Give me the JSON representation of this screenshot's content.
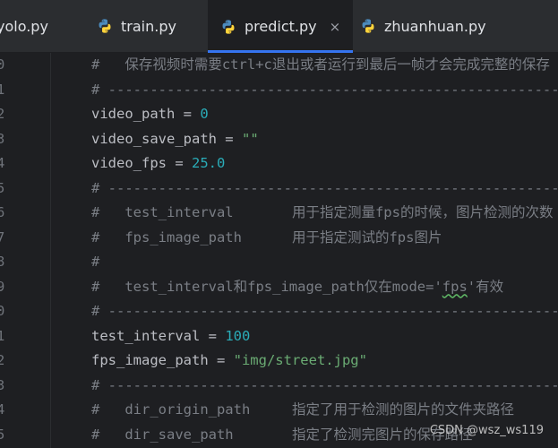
{
  "tabs": [
    {
      "label": "yolo.py",
      "active": false
    },
    {
      "label": "train.py",
      "active": false
    },
    {
      "label": "predict.py",
      "active": true,
      "close": "×"
    },
    {
      "label": "zhuanhuan.py",
      "active": false
    }
  ],
  "lines": [
    {
      "n": "0",
      "parts": [
        {
          "t": "#   保存视频时需要ctrl+c退出或者运行到最后一帧才会完成完整的保存",
          "c": "cmt"
        }
      ]
    },
    {
      "n": "1",
      "parts": [
        {
          "t": "# ------------------------------------------------------------------",
          "c": "cmt"
        }
      ]
    },
    {
      "n": "2",
      "parts": [
        {
          "t": "video_path = ",
          "c": ""
        },
        {
          "t": "0",
          "c": "num"
        }
      ]
    },
    {
      "n": "3",
      "parts": [
        {
          "t": "video_save_path = ",
          "c": ""
        },
        {
          "t": "\"\"",
          "c": "str"
        }
      ]
    },
    {
      "n": "4",
      "parts": [
        {
          "t": "video_fps = ",
          "c": ""
        },
        {
          "t": "25.0",
          "c": "num"
        }
      ]
    },
    {
      "n": "5",
      "parts": [
        {
          "t": "# ------------------------------------------------------------------",
          "c": "cmt"
        }
      ]
    },
    {
      "n": "6",
      "parts": [
        {
          "t": "#   test_interval       用于指定测量fps的时候，图片检测的次数",
          "c": "cmt"
        }
      ]
    },
    {
      "n": "7",
      "parts": [
        {
          "t": "#   fps_image_path      用于指定测试的fps图片",
          "c": "cmt"
        }
      ]
    },
    {
      "n": "8",
      "parts": [
        {
          "t": "#",
          "c": "cmt"
        }
      ]
    },
    {
      "n": "9",
      "parts": [
        {
          "t": "#   test_interval和fps_image_path仅在mode='",
          "c": "cmt"
        },
        {
          "t": "fps",
          "c": "cmt squiggle"
        },
        {
          "t": "'有效",
          "c": "cmt"
        }
      ]
    },
    {
      "n": "0",
      "parts": [
        {
          "t": "# ------------------------------------------------------------------",
          "c": "cmt"
        }
      ]
    },
    {
      "n": "1",
      "parts": [
        {
          "t": "test_interval = ",
          "c": ""
        },
        {
          "t": "100",
          "c": "num"
        }
      ]
    },
    {
      "n": "2",
      "parts": [
        {
          "t": "fps_image_path = ",
          "c": ""
        },
        {
          "t": "\"img/street.jpg\"",
          "c": "str"
        }
      ]
    },
    {
      "n": "3",
      "parts": [
        {
          "t": "# ------------------------------------------------------------------",
          "c": "cmt"
        }
      ]
    },
    {
      "n": "4",
      "parts": [
        {
          "t": "#   dir_origin_path     指定了用于检测的图片的文件夹路径",
          "c": "cmt"
        }
      ]
    },
    {
      "n": "5",
      "parts": [
        {
          "t": "#   dir_save_path       指定了检测完图片的保存路径",
          "c": "cmt"
        }
      ]
    }
  ],
  "watermark": "CSDN @wsz_ws119",
  "colors": {
    "background": "#1e1f22",
    "tabbar": "#2b2d30",
    "accent": "#3574f0",
    "comment": "#7a7e85",
    "number": "#2aacb8",
    "string": "#6aab73"
  }
}
